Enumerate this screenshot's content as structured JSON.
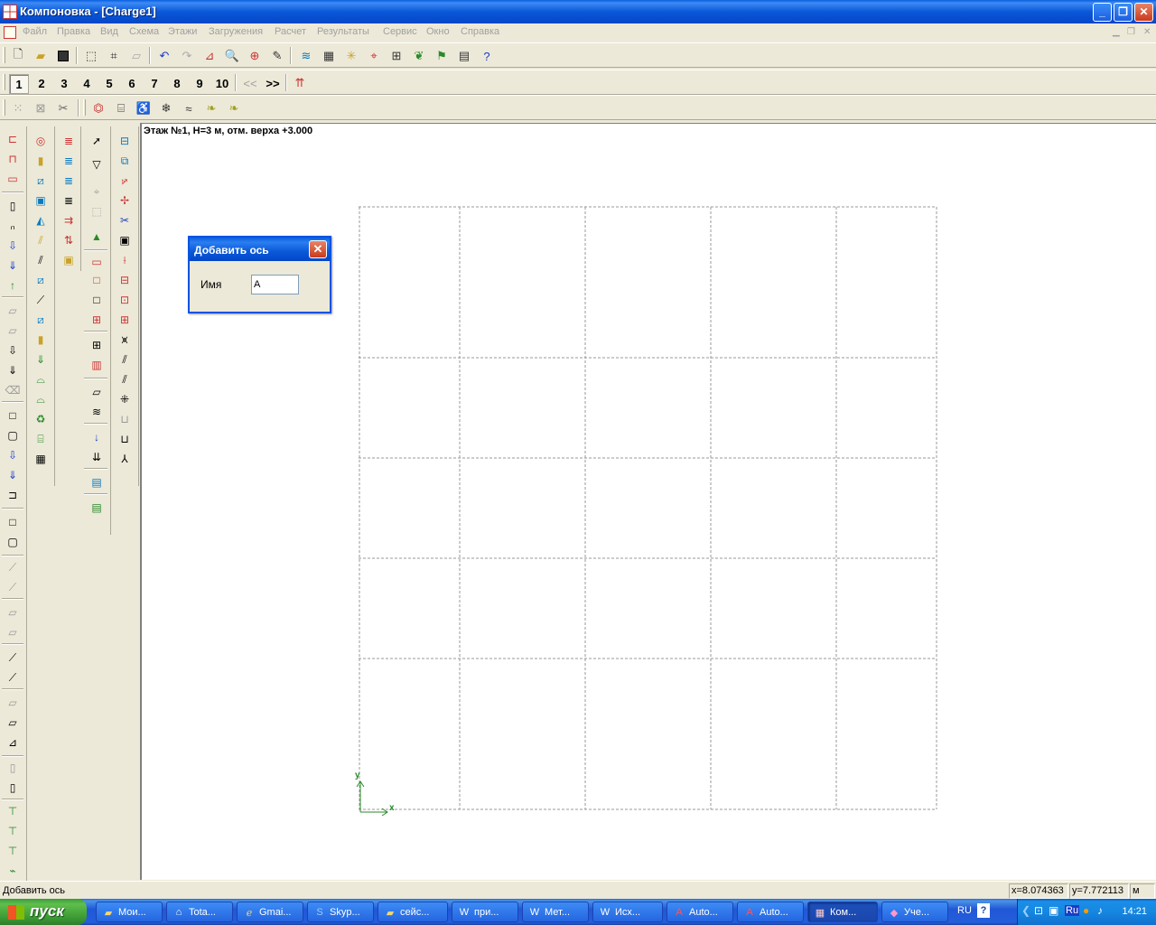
{
  "window": {
    "title": "Компоновка - [Charge1]"
  },
  "menu": [
    "Файл",
    "Правка",
    "Вид",
    "Схема",
    "Этажи",
    "Загружения",
    "Расчет",
    "Результаты",
    "Сервис",
    "Окно",
    "Справка"
  ],
  "floor_toolbar": {
    "floors": [
      "1",
      "2",
      "3",
      "4",
      "5",
      "6",
      "7",
      "8",
      "9",
      "10"
    ],
    "active_floor": "1",
    "prev": "<<",
    "next": ">>"
  },
  "canvas": {
    "floor_info": "Этаж №1, H=3 м, отм. верха +3.000",
    "axis_y": "y",
    "axis_x": "x"
  },
  "dialog": {
    "title": "Добавить ось",
    "name_label": "Имя",
    "name_value": "A"
  },
  "statusbar": {
    "text": "Добавить ось",
    "x": "x=8.074363",
    "y": "y=7.772113",
    "unit": "м"
  },
  "taskbar": {
    "start": "пуск",
    "tasks": [
      {
        "label": "Мои...",
        "icon": "folder-icon"
      },
      {
        "label": "Tota...",
        "icon": "total-commander-icon"
      },
      {
        "label": "Gmai...",
        "icon": "browser-icon"
      },
      {
        "label": "Skyp...",
        "icon": "skype-icon"
      },
      {
        "label": "сейс...",
        "icon": "folder-icon"
      },
      {
        "label": "при...",
        "icon": "word-icon"
      },
      {
        "label": "Мет...",
        "icon": "word-icon"
      },
      {
        "label": "Исх...",
        "icon": "word-icon"
      },
      {
        "label": "Auto...",
        "icon": "autocad-icon"
      },
      {
        "label": "Auto...",
        "icon": "autocad-icon"
      },
      {
        "label": "Ком...",
        "icon": "app-icon"
      },
      {
        "label": "Уче...",
        "icon": "book-icon"
      }
    ],
    "lang": "RU",
    "tray_lang": "Ru",
    "clock": "14:21"
  }
}
